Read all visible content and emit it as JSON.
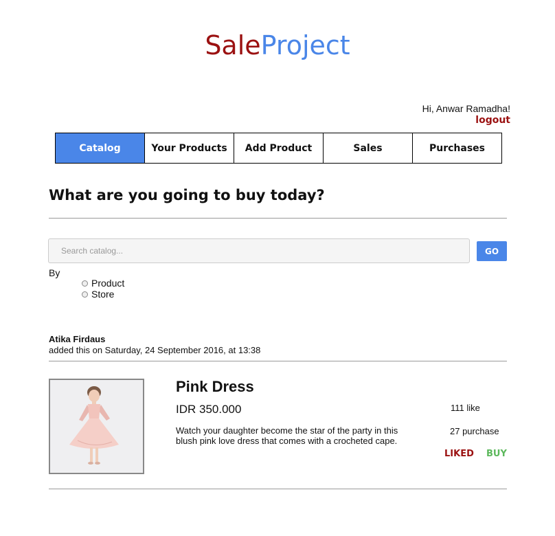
{
  "app": {
    "logo_sale": "Sale",
    "logo_project": "Project"
  },
  "user": {
    "greeting": "Hi, Anwar Ramadha!",
    "logout_label": "logout"
  },
  "nav": {
    "tabs": [
      {
        "label": "Catalog",
        "active": true
      },
      {
        "label": "Your Products",
        "active": false
      },
      {
        "label": "Add Product",
        "active": false
      },
      {
        "label": "Sales",
        "active": false
      },
      {
        "label": "Purchases",
        "active": false
      }
    ]
  },
  "main": {
    "heading": "What are you going to buy today?",
    "search": {
      "placeholder": "Search catalog...",
      "value": "",
      "go_label": "GO",
      "by_label": "By",
      "options": [
        "Product",
        "Store"
      ]
    }
  },
  "catalog": {
    "items": [
      {
        "seller": "Atika Firdaus",
        "added_text": "added this on Saturday, 24 September 2016, at 13:38",
        "title": "Pink Dress",
        "price": "IDR 350.000",
        "description": "Watch your daughter become the star of the party in this blush pink love dress that comes with a crocheted cape.",
        "likes": "111 like",
        "purchases": "27 purchase",
        "liked_label": "LIKED",
        "buy_label": "BUY"
      }
    ]
  },
  "colors": {
    "brand_red": "#9b1111",
    "brand_blue": "#4a86e8",
    "buy_green": "#5cb85c"
  }
}
